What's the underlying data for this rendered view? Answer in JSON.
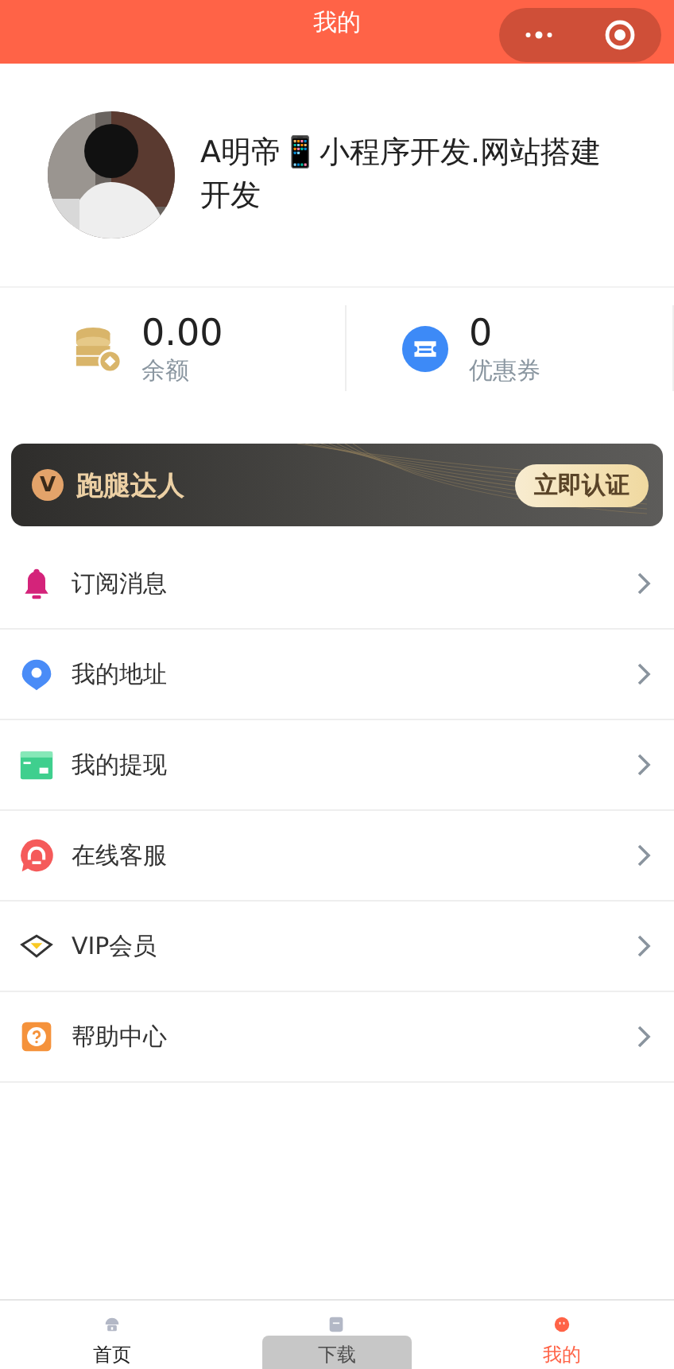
{
  "header": {
    "title": "我的"
  },
  "profile": {
    "name": "A明帝📱小程序开发.网站搭建开发"
  },
  "stats": [
    {
      "kind": "coins",
      "value": "0.00",
      "label": "余额"
    },
    {
      "kind": "ticket",
      "value": "0",
      "label": "优惠券"
    }
  ],
  "banner": {
    "badge": "V",
    "title": "跑腿达人",
    "button": "立即认证"
  },
  "menu": [
    {
      "kind": "bell",
      "label": "订阅消息"
    },
    {
      "kind": "pin",
      "label": "我的地址"
    },
    {
      "kind": "card",
      "label": "我的提现"
    },
    {
      "kind": "support",
      "label": "在线客服"
    },
    {
      "kind": "diamond",
      "label": "VIP会员"
    },
    {
      "kind": "help",
      "label": "帮助中心"
    }
  ],
  "tabs": [
    {
      "kind": "home",
      "label": "首页",
      "selected": false
    },
    {
      "kind": "order",
      "label": "下载",
      "selected": false
    },
    {
      "kind": "me",
      "label": "我的",
      "selected": true
    }
  ]
}
